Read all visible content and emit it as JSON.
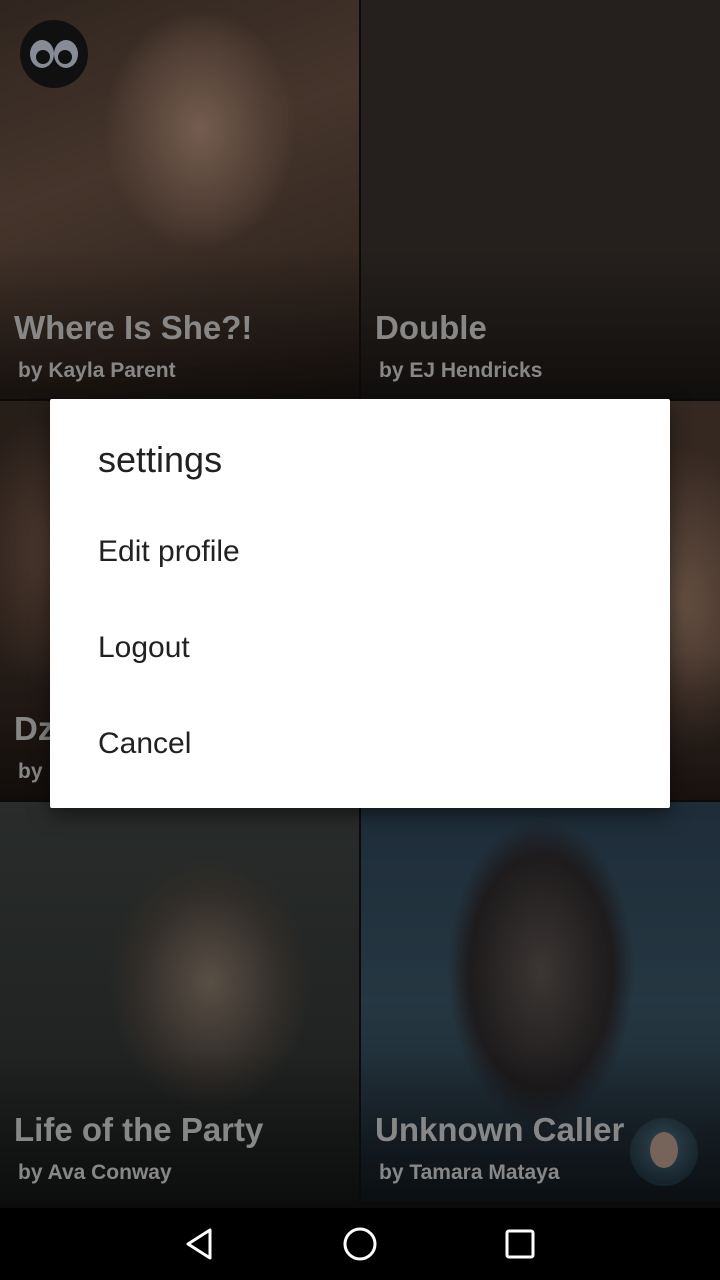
{
  "stories": [
    {
      "title": "Where Is She?!",
      "author": "by Kayla Parent"
    },
    {
      "title": "Double",
      "author": "by EJ Hendricks"
    },
    {
      "title": "Dz",
      "author": "by"
    },
    {
      "title": "",
      "author": ""
    },
    {
      "title": "Life of the Party",
      "author": "by Ava Conway"
    },
    {
      "title": "Unknown Caller",
      "author": "by Tamara Mataya"
    }
  ],
  "dialog": {
    "title": "settings",
    "items": [
      {
        "label": "Edit profile"
      },
      {
        "label": "Logout"
      },
      {
        "label": "Cancel"
      }
    ]
  },
  "icons": {
    "app_logo": "owl-logo-icon",
    "avatar": "user-avatar",
    "nav_back": "back-triangle-icon",
    "nav_home": "home-circle-icon",
    "nav_recents": "recents-square-icon"
  },
  "colors": {
    "dialog_bg": "#ffffff",
    "dialog_text": "#212121",
    "tile_text": "#cfcfcf",
    "navbar_bg": "#000000"
  }
}
